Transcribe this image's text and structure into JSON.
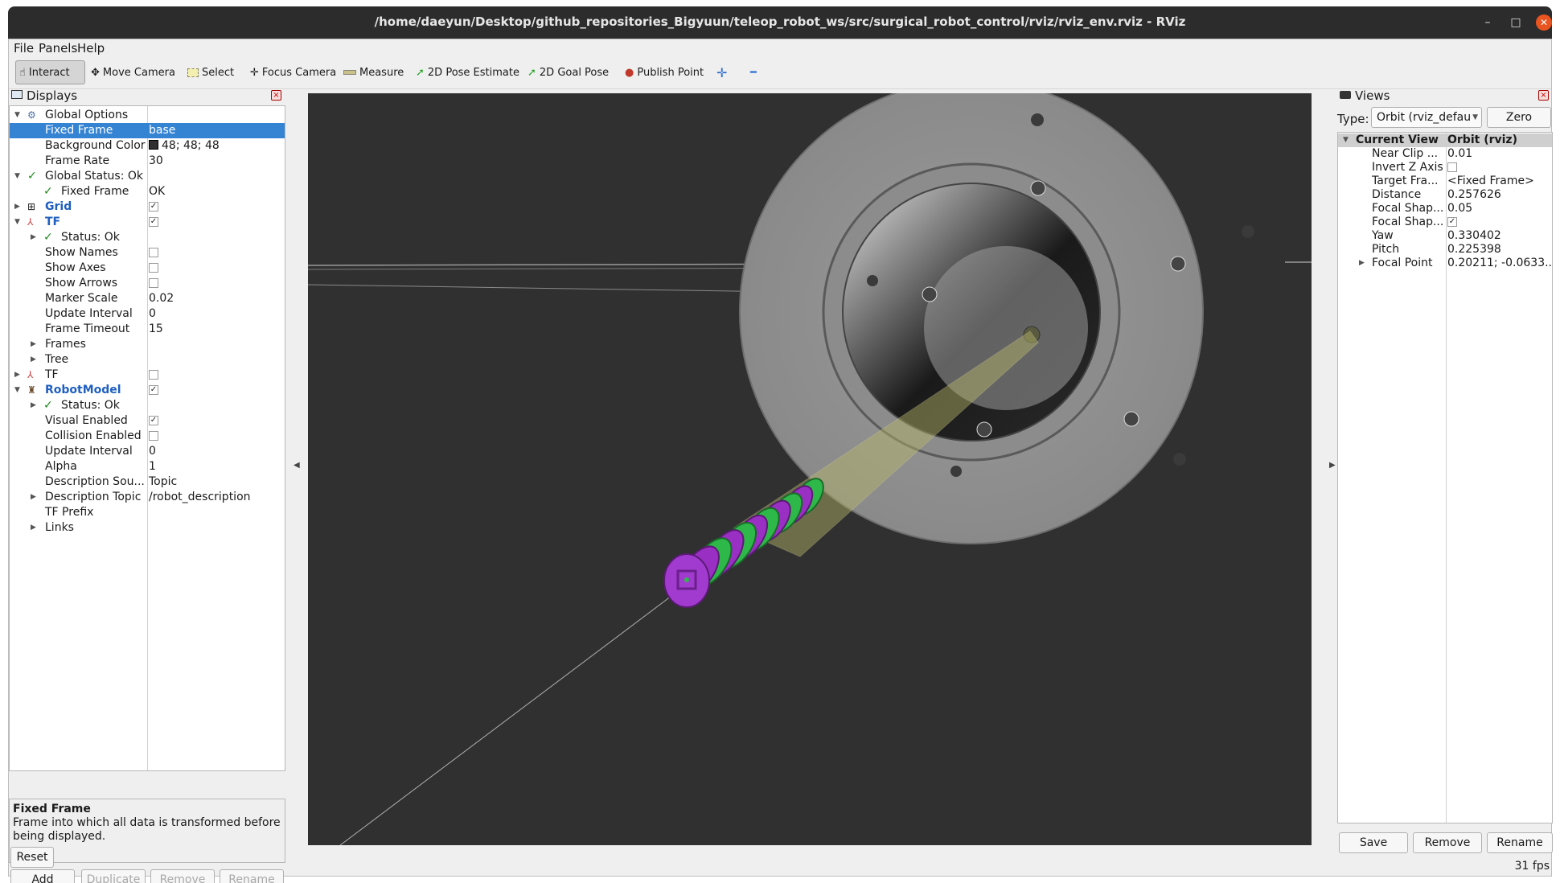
{
  "window": {
    "title": "/home/daeyun/Desktop/github_repositories_Bigyuun/teleop_robot_ws/src/surgical_robot_control/rviz/rviz_env.rviz - RViz",
    "min_glyph": "–",
    "max_glyph": "□",
    "close_glyph": "✕"
  },
  "menu": {
    "file": "File",
    "panels": "Panels",
    "help": "Help"
  },
  "toolbar": {
    "interact": "Interact",
    "move_camera": "Move Camera",
    "select": "Select",
    "focus_camera": "Focus Camera",
    "measure": "Measure",
    "pose_estimate": "2D Pose Estimate",
    "goal_pose": "2D Goal Pose",
    "publish_point": "Publish Point",
    "add_glyph": "✛",
    "remove_glyph": "━"
  },
  "displays": {
    "title": "Displays",
    "global_options": "Global Options",
    "fixed_frame_label": "Fixed Frame",
    "fixed_frame_value": "base",
    "background_color_label": "Background Color",
    "background_color_value": "48; 48; 48",
    "frame_rate_label": "Frame Rate",
    "frame_rate_value": "30",
    "global_status": "Global Status: Ok",
    "status_fixed_frame_label": "Fixed Frame",
    "status_fixed_frame_value": "OK",
    "grid": "Grid",
    "tf": "TF",
    "tf_status": "Status: Ok",
    "show_names": "Show Names",
    "show_axes": "Show Axes",
    "show_arrows": "Show Arrows",
    "marker_scale_label": "Marker Scale",
    "marker_scale_value": "0.02",
    "update_interval_label": "Update Interval",
    "update_interval_value": "0",
    "frame_timeout_label": "Frame Timeout",
    "frame_timeout_value": "15",
    "frames": "Frames",
    "tree": "Tree",
    "tf2": "TF",
    "robot_model": "RobotModel",
    "rm_status": "Status: Ok",
    "visual_enabled": "Visual Enabled",
    "collision_enabled": "Collision Enabled",
    "rm_update_interval_label": "Update Interval",
    "rm_update_interval_value": "0",
    "alpha_label": "Alpha",
    "alpha_value": "1",
    "description_source_label": "Description Sou...",
    "description_source_value": "Topic",
    "description_topic_label": "Description Topic",
    "description_topic_value": "/robot_description",
    "tf_prefix": "TF Prefix",
    "links": "Links",
    "description_title": "Fixed Frame",
    "description_text": "Frame into which all data is transformed before being displayed.",
    "add": "Add",
    "duplicate": "Duplicate",
    "remove": "Remove",
    "rename": "Rename",
    "reset": "Reset"
  },
  "views": {
    "title": "Views",
    "type_label": "Type:",
    "type_value": "Orbit (rviz_defau",
    "zero": "Zero",
    "current_view_label": "Current View",
    "current_view_value": "Orbit (rviz)",
    "near_clip_label": "Near Clip ...",
    "near_clip_value": "0.01",
    "invert_z_label": "Invert Z Axis",
    "target_frame_label": "Target Fra...",
    "target_frame_value": "<Fixed Frame>",
    "distance_label": "Distance",
    "distance_value": "0.257626",
    "focal_shape1_label": "Focal Shap...",
    "focal_shape1_value": "0.05",
    "focal_shape2_label": "Focal Shap...",
    "yaw_label": "Yaw",
    "yaw_value": "0.330402",
    "pitch_label": "Pitch",
    "pitch_value": "0.225398",
    "focal_point_label": "Focal Point",
    "focal_point_value": "0.20211; -0.0633...",
    "save": "Save",
    "remove": "Remove",
    "rename": "Rename",
    "fps": "31 fps"
  },
  "colors": {
    "background": "#303030",
    "selection": "#3584d3",
    "link_ring_green": "#2fb84a",
    "link_ring_purple": "#9a2fc4"
  }
}
